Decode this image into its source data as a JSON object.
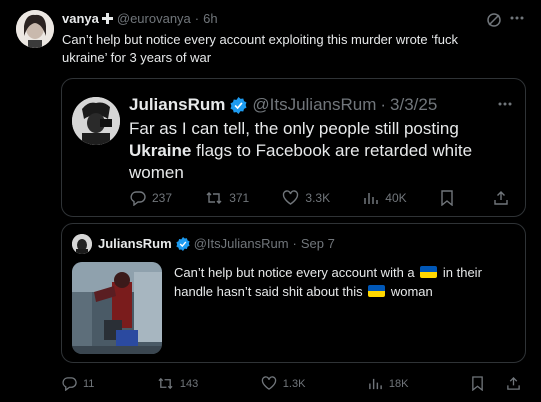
{
  "outer": {
    "name": "vanya",
    "name_icon": "cross-icon",
    "handle": "@eurovanya",
    "sep": "·",
    "time": "6h",
    "text": "Can’t help but notice every account exploiting this murder wrote ‘fuck ukraine’ for 3 years of war"
  },
  "quote1": {
    "name": "JuliansRum",
    "handle": "@ItsJuliansRum",
    "sep": "·",
    "date": "3/3/25",
    "text_a": "Far as I can tell, the only people still posting ",
    "text_bold": "Ukraine",
    "text_b": " flags to Facebook are retarded white women",
    "replies": "237",
    "reposts": "371",
    "likes": "3.3K",
    "views": "40K"
  },
  "quote2": {
    "name": "JuliansRum",
    "handle": "@ItsJuliansRum",
    "sep": "·",
    "date": "Sep 7",
    "text_a": "Can’t help but notice every account with a ",
    "text_b": " in their handle hasn’t said shit about this ",
    "text_c": " woman"
  },
  "actions": {
    "replies": "11",
    "reposts": "143",
    "likes": "1.3K",
    "views": "18K"
  },
  "colors": {
    "background": "#000000",
    "text": "#e7e9ea",
    "muted": "#71767b",
    "border": "#2f3336",
    "verified": "#1d9bf0",
    "flag_blue": "#0057b7",
    "flag_yellow": "#ffd700"
  }
}
